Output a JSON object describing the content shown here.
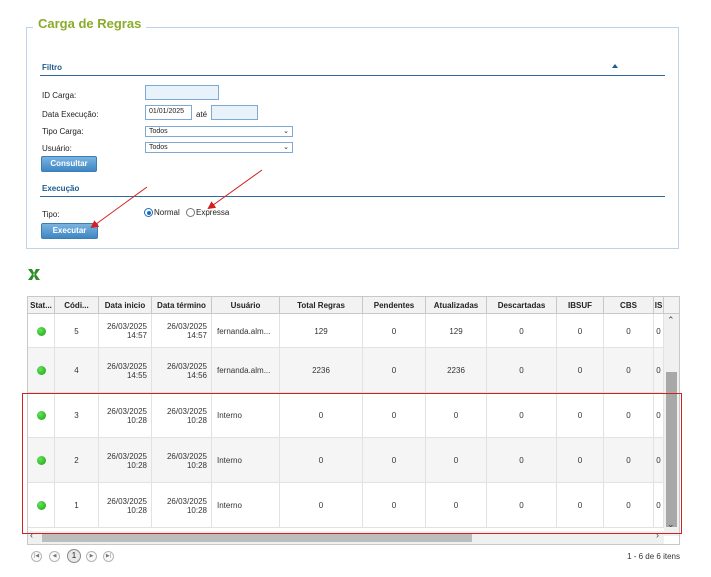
{
  "panel": {
    "title": "Carga de Regras",
    "filter": {
      "title": "Filtro",
      "id_carga_label": "ID Carga:",
      "id_carga_value": "",
      "data_execucao_label": "Data Execução:",
      "data_inicio_value": "01/01/2025",
      "ate_label": "até",
      "data_fim_value": "",
      "tipo_carga_label": "Tipo Carga:",
      "tipo_carga_value": "Todos",
      "usuario_label": "Usuário:",
      "usuario_value": "Todos",
      "consultar_label": "Consultar"
    },
    "execucao": {
      "title": "Execução",
      "tipo_label": "Tipo:",
      "options": [
        {
          "label": "Normal",
          "selected": true
        },
        {
          "label": "Expressa",
          "selected": false
        }
      ],
      "executar_label": "Executar"
    }
  },
  "export_icon": "excel-export-icon",
  "grid": {
    "columns": [
      "Stat...",
      "Códi...",
      "Data inicio",
      "Data término",
      "Usuário",
      "Total Regras",
      "Pendentes",
      "Atualizadas",
      "Descartadas",
      "IBSUF",
      "CBS",
      "IS"
    ],
    "rows": [
      {
        "status": "green",
        "codigo": "5",
        "data_inicio": "26/03/2025 14:57",
        "data_termino": "26/03/2025 14:57",
        "usuario": "fernanda.alm...",
        "total_regras": "129",
        "pendentes": "0",
        "atualizadas": "129",
        "descartadas": "0",
        "ibsuf": "0",
        "cbs": "0",
        "is": "0"
      },
      {
        "status": "green",
        "codigo": "4",
        "data_inicio": "26/03/2025 14:55",
        "data_termino": "26/03/2025 14:56",
        "usuario": "fernanda.alm...",
        "total_regras": "2236",
        "pendentes": "0",
        "atualizadas": "2236",
        "descartadas": "0",
        "ibsuf": "0",
        "cbs": "0",
        "is": "0"
      },
      {
        "status": "green",
        "codigo": "3",
        "data_inicio": "26/03/2025 10:28",
        "data_termino": "26/03/2025 10:28",
        "usuario": "Interno",
        "total_regras": "0",
        "pendentes": "0",
        "atualizadas": "0",
        "descartadas": "0",
        "ibsuf": "0",
        "cbs": "0",
        "is": "0"
      },
      {
        "status": "green",
        "codigo": "2",
        "data_inicio": "26/03/2025 10:28",
        "data_termino": "26/03/2025 10:28",
        "usuario": "Interno",
        "total_regras": "0",
        "pendentes": "0",
        "atualizadas": "0",
        "descartadas": "0",
        "ibsuf": "0",
        "cbs": "0",
        "is": "0"
      },
      {
        "status": "green",
        "codigo": "1",
        "data_inicio": "26/03/2025 10:28",
        "data_termino": "26/03/2025 10:28",
        "usuario": "Interno",
        "total_regras": "0",
        "pendentes": "0",
        "atualizadas": "0",
        "descartadas": "0",
        "ibsuf": "0",
        "cbs": "0",
        "is": "0"
      }
    ]
  },
  "pager": {
    "current_page": "1",
    "info": "1 - 6 de 6 itens"
  },
  "colors": {
    "panel_title": "#8aac2a",
    "section": "#1f5a8e",
    "button": "#3f86c4",
    "status_ok": "#17a310",
    "annotation": "#d21f1f"
  }
}
